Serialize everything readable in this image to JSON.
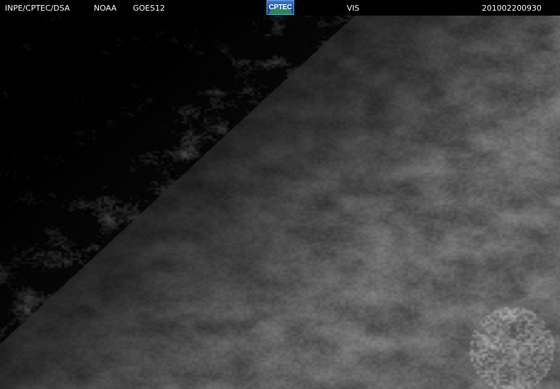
{
  "header": {
    "agency": "INPE/CPTEC/DSA",
    "provider": "NOAA",
    "satellite": "GOES12",
    "channel": "VIS",
    "timestamp": "201002200930",
    "logo_text": "CPTEC"
  },
  "image": {
    "description": "GOES12 visible satellite image, grayscale",
    "colors": {
      "dark_ocean": "#000000",
      "clouds": "#5a5a5a",
      "bright_clouds": "#9a9a9a"
    }
  }
}
